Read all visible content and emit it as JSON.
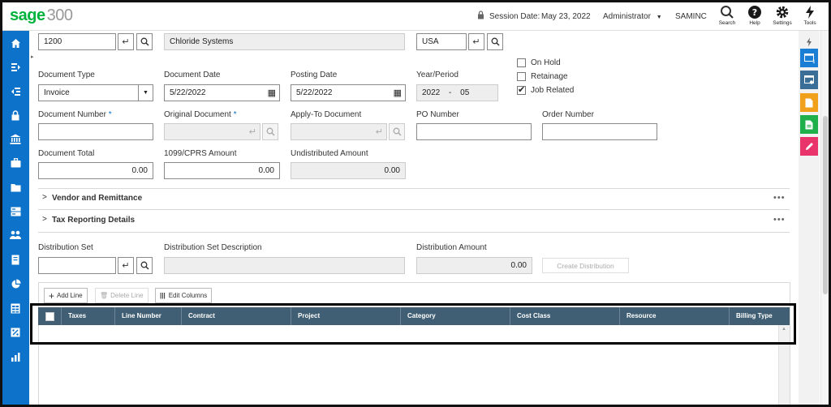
{
  "header": {
    "logo_brand": "sage",
    "logo_product": "300",
    "session_date_label": "Session Date:",
    "session_date": "May 23, 2022",
    "user": "Administrator",
    "company": "SAMINC",
    "search_label": "Search",
    "help_label": "Help",
    "settings_label": "Settings",
    "tools_label": "Tools"
  },
  "vendor": {
    "number": "1200",
    "name": "Chloride Systems",
    "country": "USA"
  },
  "document": {
    "type_label": "Document Type",
    "type_value": "Invoice",
    "date_label": "Document Date",
    "date_value": "5/22/2022",
    "posting_label": "Posting Date",
    "posting_value": "5/22/2022",
    "yp_label": "Year/Period",
    "year": "2022",
    "period_sep": "-",
    "period": "05",
    "on_hold_label": "On Hold",
    "retainage_label": "Retainage",
    "job_related_label": "Job Related",
    "number_label": "Document Number",
    "orig_label": "Original Document",
    "req_mark": "*",
    "apply_label": "Apply-To Document",
    "po_label": "PO Number",
    "order_label": "Order Number",
    "total_label": "Document Total",
    "total_value": "0.00",
    "cprs_label": "1099/CPRS Amount",
    "cprs_value": "0.00",
    "undist_label": "Undistributed Amount",
    "undist_value": "0.00"
  },
  "sections": {
    "vendor_remit": "Vendor and Remittance",
    "tax_reporting": "Tax Reporting Details",
    "more": "•••"
  },
  "distribution": {
    "set_label": "Distribution Set",
    "desc_label": "Distribution Set Description",
    "amount_label": "Distribution Amount",
    "amount_value": "0.00",
    "create_btn": "Create Distribution"
  },
  "grid": {
    "add_line": "Add Line",
    "delete_line": "Delete Line",
    "edit_columns": "Edit Columns",
    "columns": [
      "Taxes",
      "Line Number",
      "Contract",
      "Project",
      "Category",
      "Cost Class",
      "Resource",
      "Billing Type"
    ]
  },
  "colors": {
    "brand_green": "#00b33c",
    "sidebar_blue": "#0d72c9",
    "grid_header": "#415f74"
  }
}
